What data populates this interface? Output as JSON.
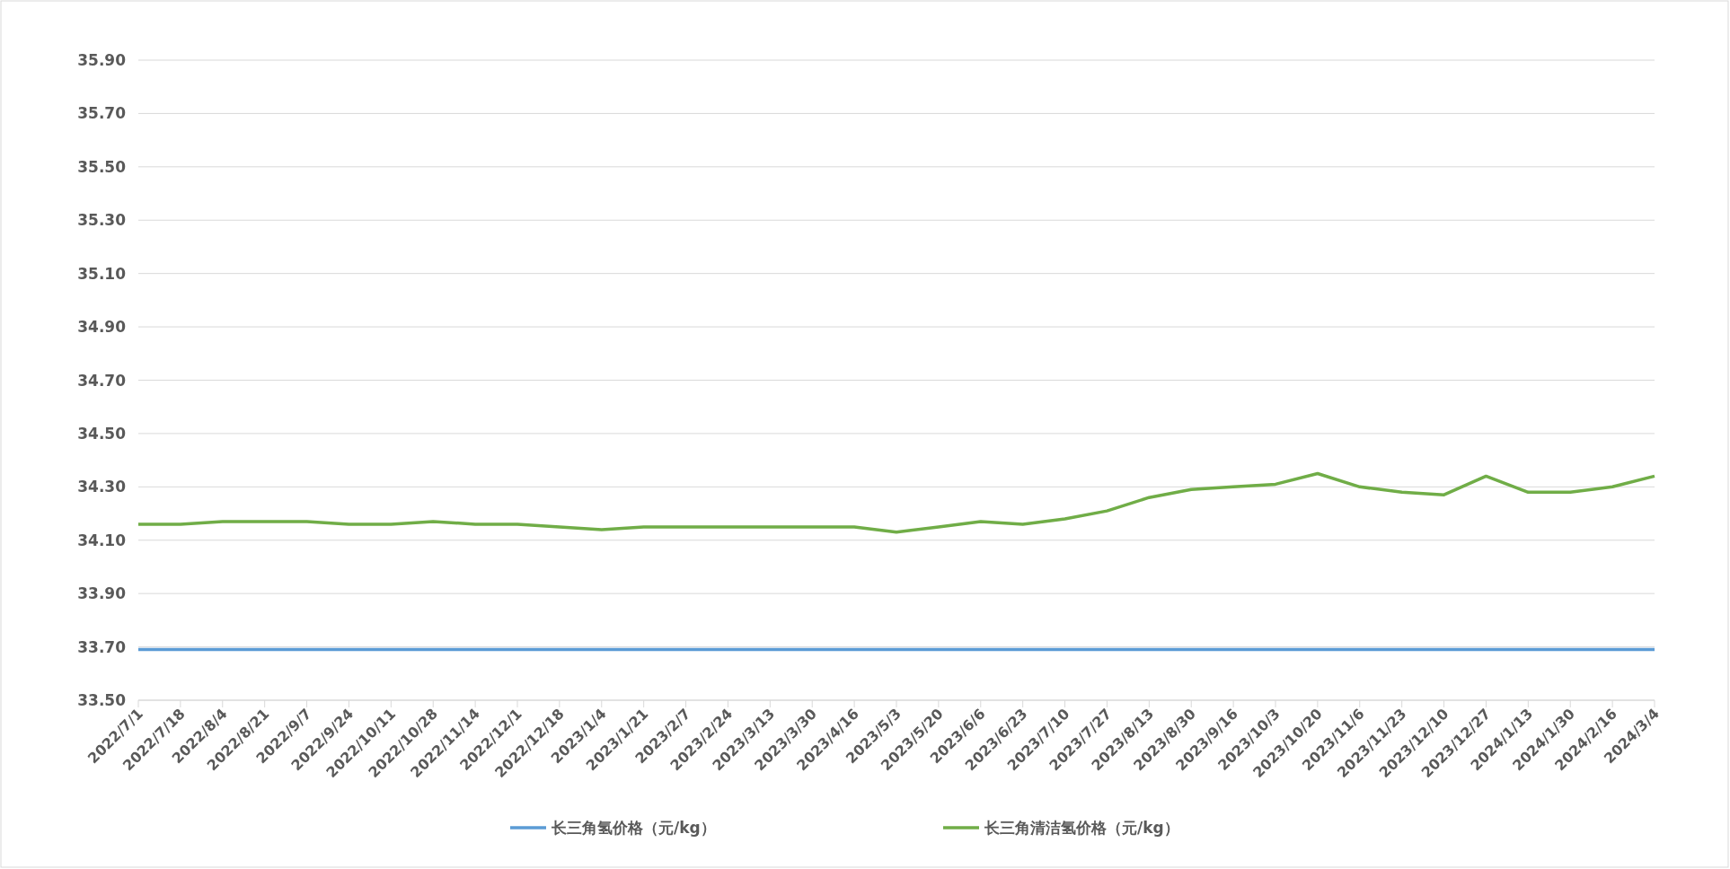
{
  "chart_data": {
    "type": "line",
    "categories": [
      "2022/7/1",
      "2022/7/18",
      "2022/8/4",
      "2022/8/21",
      "2022/9/7",
      "2022/9/24",
      "2022/10/11",
      "2022/10/28",
      "2022/11/14",
      "2022/12/1",
      "2022/12/18",
      "2023/1/4",
      "2023/1/21",
      "2023/2/7",
      "2023/2/24",
      "2023/3/13",
      "2023/3/30",
      "2023/4/16",
      "2023/5/3",
      "2023/5/20",
      "2023/6/6",
      "2023/6/23",
      "2023/7/10",
      "2023/7/27",
      "2023/8/13",
      "2023/8/30",
      "2023/9/16",
      "2023/10/3",
      "2023/10/20",
      "2023/11/6",
      "2023/11/23",
      "2023/12/10",
      "2023/12/27",
      "2024/1/13",
      "2024/1/30",
      "2024/2/16",
      "2024/3/4"
    ],
    "series": [
      {
        "name": "长三角氢价格（元/kg）",
        "color": "#5b9bd5",
        "values": [
          33.69,
          33.69,
          33.69,
          33.69,
          33.69,
          33.69,
          33.69,
          33.69,
          33.69,
          33.69,
          33.69,
          33.69,
          33.69,
          33.69,
          33.69,
          33.69,
          33.69,
          33.69,
          33.69,
          33.69,
          33.69,
          33.69,
          33.69,
          33.69,
          33.69,
          33.69,
          33.69,
          33.69,
          33.69,
          33.69,
          33.69,
          33.69,
          33.69,
          33.69,
          33.69,
          33.69,
          33.69
        ]
      },
      {
        "name": "长三角清洁氢价格（元/kg）",
        "color": "#70ad47",
        "values": [
          34.16,
          34.16,
          34.17,
          34.17,
          34.17,
          34.16,
          34.16,
          34.17,
          34.16,
          34.16,
          34.15,
          34.14,
          34.15,
          34.15,
          34.15,
          34.15,
          34.15,
          34.15,
          34.13,
          34.15,
          34.17,
          34.16,
          34.18,
          34.21,
          34.26,
          34.29,
          34.3,
          34.31,
          34.35,
          34.3,
          34.28,
          34.27,
          34.34,
          34.28,
          34.28,
          34.3,
          34.34
        ]
      }
    ],
    "ylim": [
      33.5,
      35.9
    ],
    "grid": "horizontal",
    "legend": "bottom",
    "yticks": [
      {
        "value": 33.5,
        "label": "33.50"
      },
      {
        "value": 33.7,
        "label": "33.70"
      },
      {
        "value": 33.9,
        "label": "33.90"
      },
      {
        "value": 34.1,
        "label": "34.10"
      },
      {
        "value": 34.3,
        "label": "34.30"
      },
      {
        "value": 34.5,
        "label": "34.50"
      },
      {
        "value": 34.7,
        "label": "34.70"
      },
      {
        "value": 34.9,
        "label": "34.90"
      },
      {
        "value": 35.1,
        "label": "35.10"
      },
      {
        "value": 35.3,
        "label": "35.30"
      },
      {
        "value": 35.5,
        "label": "35.50"
      },
      {
        "value": 35.7,
        "label": "35.70"
      },
      {
        "value": 35.9,
        "label": "35.90"
      }
    ]
  }
}
